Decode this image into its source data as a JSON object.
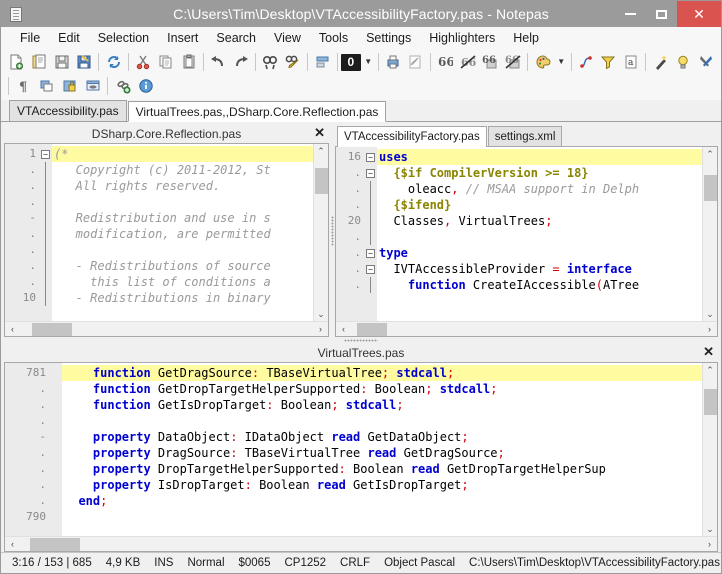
{
  "window": {
    "title": "C:\\Users\\Tim\\Desktop\\VTAccessibilityFactory.pas - Notepas",
    "app_icon": "document-icon",
    "minimize_label": "–",
    "maximize_label": "❑",
    "close_label": "✕",
    "titlebar_color": "#9b9b9b",
    "close_color": "#d9534f"
  },
  "menu": {
    "items": [
      {
        "label": "File"
      },
      {
        "label": "Edit"
      },
      {
        "label": "Selection"
      },
      {
        "label": "Insert"
      },
      {
        "label": "Search"
      },
      {
        "label": "View"
      },
      {
        "label": "Tools"
      },
      {
        "label": "Settings"
      },
      {
        "label": "Highlighters"
      },
      {
        "label": "Help"
      }
    ]
  },
  "toolbar": {
    "row1": [
      {
        "name": "new-file-icon"
      },
      {
        "name": "open-file-icon"
      },
      {
        "name": "save-icon"
      },
      {
        "name": "save-as-icon"
      },
      {
        "name": "sep"
      },
      {
        "name": "reload-icon"
      },
      {
        "name": "sep"
      },
      {
        "name": "cut-icon"
      },
      {
        "name": "copy-icon"
      },
      {
        "name": "paste-icon"
      },
      {
        "name": "sep"
      },
      {
        "name": "undo-icon"
      },
      {
        "name": "redo-icon"
      },
      {
        "name": "sep"
      },
      {
        "name": "find-icon"
      },
      {
        "name": "replace-icon"
      },
      {
        "name": "sep"
      },
      {
        "name": "align-icon"
      },
      {
        "name": "sep"
      },
      {
        "name": "bookmark-counter",
        "value": "0"
      },
      {
        "name": "bookmark-dropdown-icon"
      },
      {
        "name": "sep"
      },
      {
        "name": "print-icon"
      },
      {
        "name": "edit-mode-icon"
      },
      {
        "name": "sep"
      },
      {
        "name": "quote-icon"
      },
      {
        "name": "unquote-icon"
      },
      {
        "name": "comment-icon"
      },
      {
        "name": "uncomment-icon"
      },
      {
        "name": "sep"
      },
      {
        "name": "palette-icon"
      },
      {
        "name": "palette-dropdown-icon"
      },
      {
        "name": "sep"
      },
      {
        "name": "shape-icon"
      },
      {
        "name": "filter-icon"
      },
      {
        "name": "char-map-icon"
      },
      {
        "name": "sep"
      },
      {
        "name": "magic-wand-icon"
      },
      {
        "name": "hint-icon"
      },
      {
        "name": "tools-icon"
      }
    ],
    "row2": [
      {
        "name": "sep"
      },
      {
        "name": "pilcrow-icon"
      },
      {
        "name": "windows-icon"
      },
      {
        "name": "lock-icon"
      },
      {
        "name": "monitor-icon"
      },
      {
        "name": "sep"
      },
      {
        "name": "add-link-icon"
      },
      {
        "name": "info-icon"
      }
    ]
  },
  "file_tabs": [
    {
      "label": "VTAccessibility.pas",
      "active": false
    },
    {
      "label": "VirtualTrees.pas,,DSharp.Core.Reflection.pas",
      "active": true
    }
  ],
  "left_pane": {
    "title": "DSharp.Core.Reflection.pas",
    "close_label": "✕",
    "lines": [
      {
        "num": "1",
        "fold": "box",
        "highlight": true,
        "tokens": [
          {
            "t": "(*",
            "c": "cm"
          }
        ]
      },
      {
        "num": ".",
        "fold": "line",
        "highlight": false,
        "tokens": [
          {
            "t": "   Copyright (c) 2011-2012, St",
            "c": "cm"
          }
        ]
      },
      {
        "num": ".",
        "fold": "line",
        "highlight": false,
        "tokens": [
          {
            "t": "   All rights reserved.",
            "c": "cm"
          }
        ]
      },
      {
        "num": ".",
        "fold": "line",
        "highlight": false,
        "tokens": [
          {
            "t": "",
            "c": "cm"
          }
        ]
      },
      {
        "num": "-",
        "fold": "line",
        "highlight": false,
        "tokens": [
          {
            "t": "   Redistribution and use in s",
            "c": "cm"
          }
        ]
      },
      {
        "num": ".",
        "fold": "line",
        "highlight": false,
        "tokens": [
          {
            "t": "   modification, are permitted",
            "c": "cm"
          }
        ]
      },
      {
        "num": ".",
        "fold": "line",
        "highlight": false,
        "tokens": [
          {
            "t": "",
            "c": "cm"
          }
        ]
      },
      {
        "num": ".",
        "fold": "line",
        "highlight": false,
        "tokens": [
          {
            "t": "   - Redistributions of source",
            "c": "cm"
          }
        ]
      },
      {
        "num": ".",
        "fold": "line",
        "highlight": false,
        "tokens": [
          {
            "t": "     this list of conditions a",
            "c": "cm"
          }
        ]
      },
      {
        "num": "10",
        "fold": "line",
        "highlight": false,
        "tokens": [
          {
            "t": "   - Redistributions in binary",
            "c": "cm"
          }
        ]
      }
    ],
    "hscroll_left_arrow": "‹",
    "hscroll_right_arrow": "›",
    "vscroll_up_arrow": "⌃",
    "vscroll_down_arrow": "⌄"
  },
  "right_pane": {
    "tabs": [
      {
        "label": "VTAccessibilityFactory.pas",
        "active": true
      },
      {
        "label": "settings.xml",
        "active": false
      }
    ],
    "lines": [
      {
        "num": "16",
        "fold": "box",
        "highlight": true,
        "tokens": [
          {
            "t": "uses",
            "c": "kw"
          }
        ]
      },
      {
        "num": ".",
        "fold": "box",
        "highlight": false,
        "tokens": [
          {
            "t": "  ",
            "c": "id"
          },
          {
            "t": "{$if CompilerVersion >= 18}",
            "c": "dir"
          }
        ]
      },
      {
        "num": ".",
        "fold": "line",
        "highlight": false,
        "tokens": [
          {
            "t": "    oleacc",
            "c": "id"
          },
          {
            "t": ",",
            "c": "pn"
          },
          {
            "t": " // MSAA support in Delph",
            "c": "cm"
          }
        ]
      },
      {
        "num": ".",
        "fold": "line",
        "highlight": false,
        "tokens": [
          {
            "t": "  ",
            "c": "id"
          },
          {
            "t": "{$ifend}",
            "c": "dir"
          }
        ]
      },
      {
        "num": "20",
        "fold": "line",
        "highlight": false,
        "tokens": [
          {
            "t": "  Classes",
            "c": "id"
          },
          {
            "t": ",",
            "c": "pn"
          },
          {
            "t": " VirtualTrees",
            "c": "id"
          },
          {
            "t": ";",
            "c": "pn"
          }
        ]
      },
      {
        "num": ".",
        "fold": "line",
        "highlight": false,
        "tokens": [
          {
            "t": "",
            "c": "id"
          }
        ]
      },
      {
        "num": ".",
        "fold": "box",
        "highlight": false,
        "tokens": [
          {
            "t": "type",
            "c": "kw"
          }
        ]
      },
      {
        "num": ".",
        "fold": "box",
        "highlight": false,
        "tokens": [
          {
            "t": "  IVTAccessibleProvider ",
            "c": "id"
          },
          {
            "t": "=",
            "c": "pn"
          },
          {
            "t": " interface",
            "c": "kw"
          }
        ]
      },
      {
        "num": ".",
        "fold": "line",
        "highlight": false,
        "tokens": [
          {
            "t": "    ",
            "c": "id"
          },
          {
            "t": "function",
            "c": "kw"
          },
          {
            "t": " CreateIAccessible",
            "c": "id"
          },
          {
            "t": "(",
            "c": "pn"
          },
          {
            "t": "ATree",
            "c": "id"
          }
        ]
      }
    ],
    "hscroll_left_arrow": "‹",
    "hscroll_right_arrow": "›",
    "vscroll_up_arrow": "⌃",
    "vscroll_down_arrow": "⌄"
  },
  "bottom_pane": {
    "title": "VirtualTrees.pas",
    "close_label": "✕",
    "lines": [
      {
        "num": "781",
        "fold": "",
        "highlight": true,
        "tokens": [
          {
            "t": "    ",
            "c": "id"
          },
          {
            "t": "function",
            "c": "kw"
          },
          {
            "t": " GetDragSource",
            "c": "id"
          },
          {
            "t": ":",
            "c": "pn"
          },
          {
            "t": " TBaseVirtualTree",
            "c": "id"
          },
          {
            "t": ";",
            "c": "pn"
          },
          {
            "t": " stdcall",
            "c": "kw"
          },
          {
            "t": ";",
            "c": "pn"
          }
        ]
      },
      {
        "num": ".",
        "fold": "",
        "highlight": false,
        "tokens": [
          {
            "t": "    ",
            "c": "id"
          },
          {
            "t": "function",
            "c": "kw"
          },
          {
            "t": " GetDropTargetHelperSupported",
            "c": "id"
          },
          {
            "t": ":",
            "c": "pn"
          },
          {
            "t": " Boolean",
            "c": "id"
          },
          {
            "t": ";",
            "c": "pn"
          },
          {
            "t": " stdcall",
            "c": "kw"
          },
          {
            "t": ";",
            "c": "pn"
          }
        ]
      },
      {
        "num": ".",
        "fold": "",
        "highlight": false,
        "tokens": [
          {
            "t": "    ",
            "c": "id"
          },
          {
            "t": "function",
            "c": "kw"
          },
          {
            "t": " GetIsDropTarget",
            "c": "id"
          },
          {
            "t": ":",
            "c": "pn"
          },
          {
            "t": " Boolean",
            "c": "id"
          },
          {
            "t": ";",
            "c": "pn"
          },
          {
            "t": " stdcall",
            "c": "kw"
          },
          {
            "t": ";",
            "c": "pn"
          }
        ]
      },
      {
        "num": ".",
        "fold": "",
        "highlight": false,
        "tokens": [
          {
            "t": "",
            "c": "id"
          }
        ]
      },
      {
        "num": "-",
        "fold": "",
        "highlight": false,
        "tokens": [
          {
            "t": "    ",
            "c": "id"
          },
          {
            "t": "property",
            "c": "kw"
          },
          {
            "t": " DataObject",
            "c": "id"
          },
          {
            "t": ":",
            "c": "pn"
          },
          {
            "t": " IDataObject ",
            "c": "id"
          },
          {
            "t": "read",
            "c": "kw"
          },
          {
            "t": " GetDataObject",
            "c": "id"
          },
          {
            "t": ";",
            "c": "pn"
          }
        ]
      },
      {
        "num": ".",
        "fold": "",
        "highlight": false,
        "tokens": [
          {
            "t": "    ",
            "c": "id"
          },
          {
            "t": "property",
            "c": "kw"
          },
          {
            "t": " DragSource",
            "c": "id"
          },
          {
            "t": ":",
            "c": "pn"
          },
          {
            "t": " TBaseVirtualTree ",
            "c": "id"
          },
          {
            "t": "read",
            "c": "kw"
          },
          {
            "t": " GetDragSource",
            "c": "id"
          },
          {
            "t": ";",
            "c": "pn"
          }
        ]
      },
      {
        "num": ".",
        "fold": "",
        "highlight": false,
        "tokens": [
          {
            "t": "    ",
            "c": "id"
          },
          {
            "t": "property",
            "c": "kw"
          },
          {
            "t": " DropTargetHelperSupported",
            "c": "id"
          },
          {
            "t": ":",
            "c": "pn"
          },
          {
            "t": " Boolean ",
            "c": "id"
          },
          {
            "t": "read",
            "c": "kw"
          },
          {
            "t": " GetDropTargetHelperSup",
            "c": "id"
          }
        ]
      },
      {
        "num": ".",
        "fold": "",
        "highlight": false,
        "tokens": [
          {
            "t": "    ",
            "c": "id"
          },
          {
            "t": "property",
            "c": "kw"
          },
          {
            "t": " IsDropTarget",
            "c": "id"
          },
          {
            "t": ":",
            "c": "pn"
          },
          {
            "t": " Boolean ",
            "c": "id"
          },
          {
            "t": "read",
            "c": "kw"
          },
          {
            "t": " GetIsDropTarget",
            "c": "id"
          },
          {
            "t": ";",
            "c": "pn"
          }
        ]
      },
      {
        "num": ".",
        "fold": "",
        "highlight": false,
        "tokens": [
          {
            "t": "  ",
            "c": "id"
          },
          {
            "t": "end",
            "c": "kw"
          },
          {
            "t": ";",
            "c": "pn"
          }
        ]
      },
      {
        "num": "790",
        "fold": "",
        "highlight": false,
        "tokens": [
          {
            "t": "",
            "c": "id"
          }
        ]
      }
    ],
    "hscroll_left_arrow": "‹",
    "hscroll_right_arrow": "›",
    "vscroll_up_arrow": "⌃",
    "vscroll_down_arrow": "⌄"
  },
  "statusbar": {
    "caret": "3:16 / 153 | 685",
    "size": "4,9 KB",
    "insert_mode": "INS",
    "select_mode": "Normal",
    "char_code": "$0065",
    "encoding": "CP1252",
    "line_ending": "CRLF",
    "highlighter": "Object Pascal",
    "file_path": "C:\\Users\\Tim\\Desktop\\VTAccessibilityFactory.pas"
  }
}
